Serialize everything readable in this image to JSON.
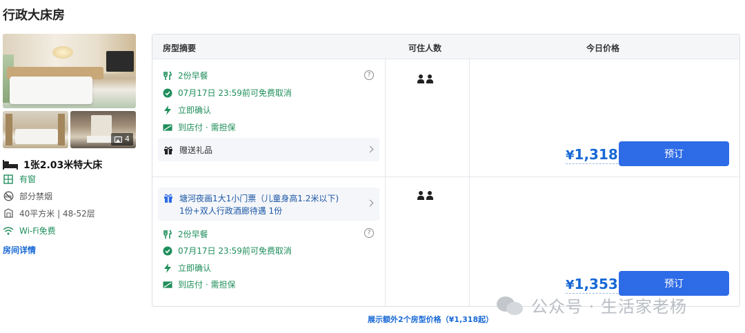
{
  "room": {
    "title": "行政大床房",
    "photo_count": "4",
    "bed_type": "1张2.03米特大床",
    "features": [
      {
        "icon": "window-icon",
        "text": "有窗",
        "green": true
      },
      {
        "icon": "no-smoking-icon",
        "text": "部分禁烟",
        "green": false
      },
      {
        "icon": "area-icon",
        "text": "40平方米 | 48-52层",
        "green": false
      },
      {
        "icon": "wifi-icon",
        "text": "Wi-Fi免费",
        "green": true
      }
    ],
    "details_link": "房间详情"
  },
  "table": {
    "headers": {
      "summary": "房型摘要",
      "occupancy": "可住人数",
      "price": "今日价格"
    },
    "rows": [
      {
        "items": [
          {
            "icon": "breakfast-icon",
            "text": "2份早餐",
            "green": true
          },
          {
            "icon": "check-circle-icon",
            "text": "07月17日 23:59前可免费取消",
            "green": true
          },
          {
            "icon": "lightning-icon",
            "text": "立即确认",
            "green": true
          },
          {
            "icon": "pay-at-hotel-icon",
            "text": "到店付 · 需担保",
            "green": true
          }
        ],
        "gift": {
          "text": "赠送礼品"
        },
        "occupancy": 2,
        "price_symbol": "¥",
        "price": "1,318",
        "book_label": "预订"
      },
      {
        "package": {
          "line1": "塘河夜画1大1小门票（儿童身高1.2米以下)",
          "line2": "1份+双人行政酒廊待遇 1份"
        },
        "items": [
          {
            "icon": "breakfast-icon",
            "text": "2份早餐",
            "green": true
          },
          {
            "icon": "check-circle-icon",
            "text": "07月17日 23:59前可免费取消",
            "green": true
          },
          {
            "icon": "lightning-icon",
            "text": "立即确认",
            "green": true
          },
          {
            "icon": "pay-at-hotel-icon",
            "text": "到店付 · 需担保",
            "green": true
          }
        ],
        "occupancy": 2,
        "price_symbol": "¥",
        "price": "1,353",
        "book_label": "预订"
      }
    ],
    "more_link": "展示额外2个房型价格（¥1,318起）"
  },
  "watermark": "公众号 · 生活家老杨",
  "colors": {
    "accent": "#2e6be6",
    "price": "#1768d6",
    "green": "#1e8e5a"
  }
}
